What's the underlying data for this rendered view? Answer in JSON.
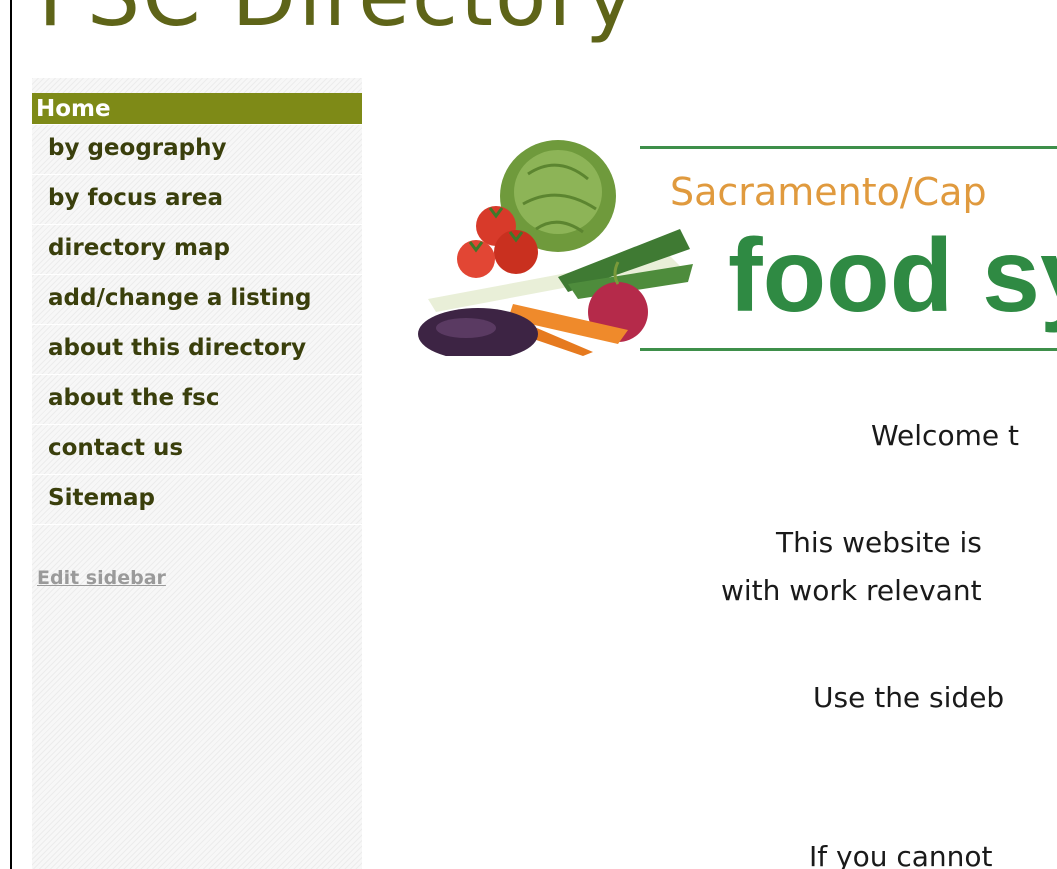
{
  "site": {
    "title": "FSC Directory"
  },
  "sidebar": {
    "items": [
      {
        "label": "Home",
        "active": true
      },
      {
        "label": "by geography"
      },
      {
        "label": "by focus area"
      },
      {
        "label": "directory map"
      },
      {
        "label": "add/change a listing"
      },
      {
        "label": "about this directory"
      },
      {
        "label": "about the fsc"
      },
      {
        "label": "contact us"
      },
      {
        "label": "Sitemap"
      }
    ],
    "edit_link": "Edit sidebar"
  },
  "banner": {
    "subtitle": "Sacramento/Cap",
    "headline": "food sy"
  },
  "content": {
    "lines": [
      "Welcome t",
      "This website is",
      "with work relevant",
      "Use the sideb",
      "If you cannot"
    ]
  },
  "colors": {
    "title_olive": "#5e6418",
    "nav_active_bg": "#7e8a17",
    "nav_text": "#3a3f0c",
    "banner_orange": "#e09a3e",
    "banner_green": "#2f8a43"
  }
}
